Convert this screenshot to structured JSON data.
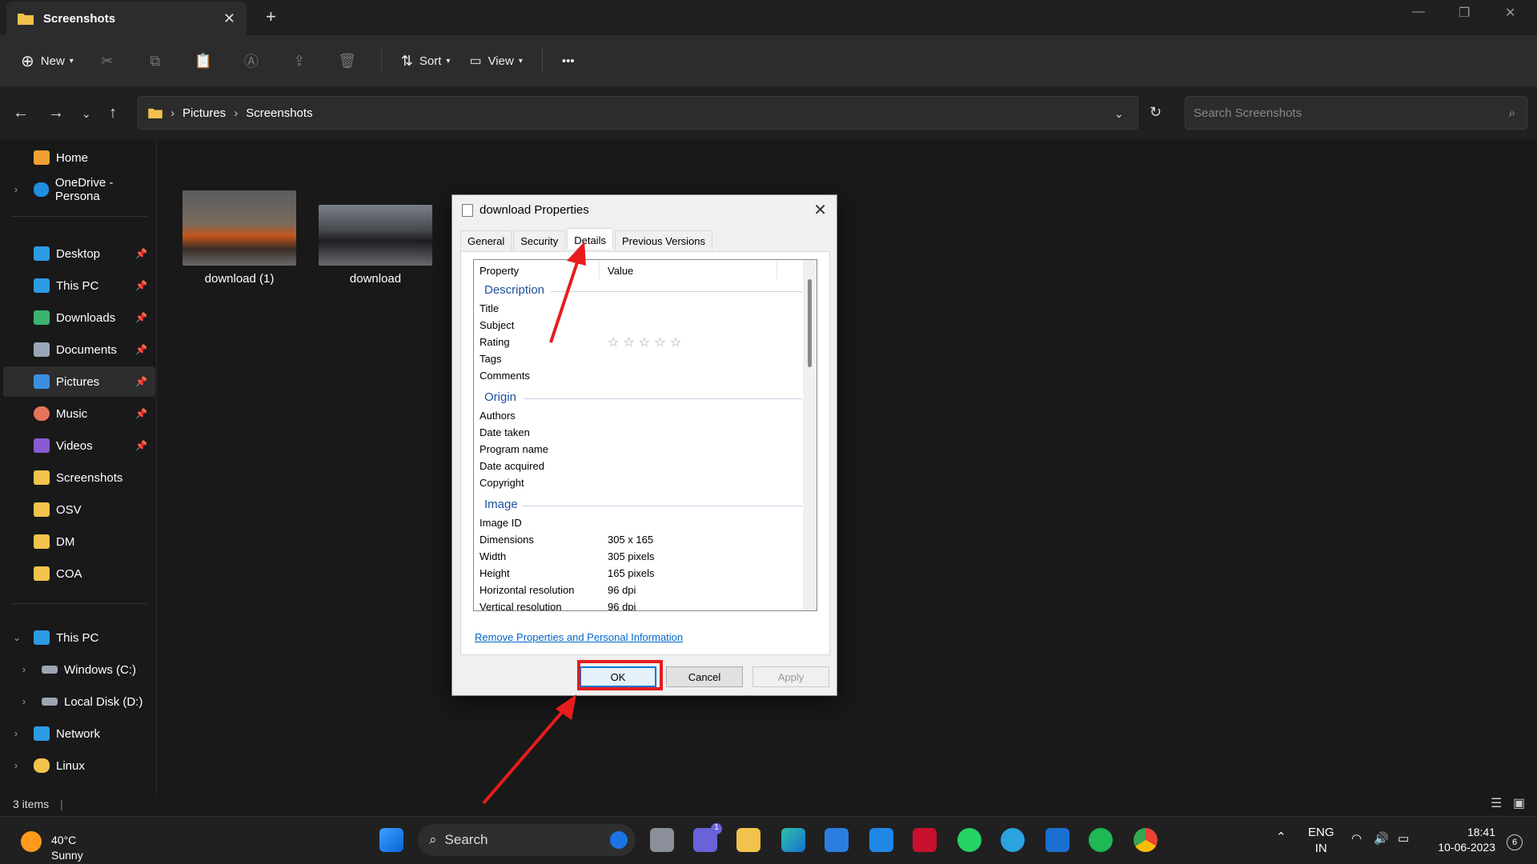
{
  "window": {
    "tab_title": "Screenshots",
    "new_tab": "+"
  },
  "toolbar": {
    "new_label": "New",
    "sort_label": "Sort",
    "view_label": "View",
    "more_label": "•••"
  },
  "address": {
    "crumbs": [
      "Pictures",
      "Screenshots"
    ],
    "search_placeholder": "Search Screenshots"
  },
  "sidebar": {
    "items": [
      {
        "label": "Home",
        "color": "#f0a030"
      },
      {
        "label": "OneDrive - Persona",
        "color": "#1f8fe0"
      },
      {
        "label": "Desktop",
        "color": "#2b9be3",
        "pinned": true
      },
      {
        "label": "This PC",
        "color": "#2b9be3",
        "pinned": true
      },
      {
        "label": "Downloads",
        "color": "#3cb371",
        "pinned": true
      },
      {
        "label": "Documents",
        "color": "#9aa6b8",
        "pinned": true
      },
      {
        "label": "Pictures",
        "color": "#3a8fe0",
        "pinned": true,
        "selected": true
      },
      {
        "label": "Music",
        "color": "#e8735a",
        "pinned": true
      },
      {
        "label": "Videos",
        "color": "#8a5ad0",
        "pinned": true
      },
      {
        "label": "Screenshots",
        "color": "#f2c24c"
      },
      {
        "label": "OSV",
        "color": "#f2c24c"
      },
      {
        "label": "DM",
        "color": "#f2c24c"
      },
      {
        "label": "COA",
        "color": "#f2c24c"
      },
      {
        "label": "This PC",
        "color": "#2b9be3"
      },
      {
        "label": "Windows (C:)",
        "color": "#9aa6b8"
      },
      {
        "label": "Local Disk (D:)",
        "color": "#9aa6b8"
      },
      {
        "label": "Network",
        "color": "#2b9be3"
      },
      {
        "label": "Linux",
        "color": "#f2c24c"
      }
    ]
  },
  "files": [
    {
      "name": "download (1)"
    },
    {
      "name": "download"
    }
  ],
  "status": {
    "items": "3 items"
  },
  "dialog": {
    "title": "download Properties",
    "tabs": [
      "General",
      "Security",
      "Details",
      "Previous Versions"
    ],
    "active_tab": "Details",
    "col_property": "Property",
    "col_value": "Value",
    "groups": {
      "description": "Description",
      "origin": "Origin",
      "image": "Image"
    },
    "description_rows": [
      {
        "p": "Title",
        "v": ""
      },
      {
        "p": "Subject",
        "v": ""
      },
      {
        "p": "Rating",
        "v": "☆ ☆ ☆ ☆ ☆"
      },
      {
        "p": "Tags",
        "v": ""
      },
      {
        "p": "Comments",
        "v": ""
      }
    ],
    "origin_rows": [
      {
        "p": "Authors",
        "v": ""
      },
      {
        "p": "Date taken",
        "v": ""
      },
      {
        "p": "Program name",
        "v": ""
      },
      {
        "p": "Date acquired",
        "v": ""
      },
      {
        "p": "Copyright",
        "v": ""
      }
    ],
    "image_rows": [
      {
        "p": "Image ID",
        "v": ""
      },
      {
        "p": "Dimensions",
        "v": "305 x 165"
      },
      {
        "p": "Width",
        "v": "305 pixels"
      },
      {
        "p": "Height",
        "v": "165 pixels"
      },
      {
        "p": "Horizontal resolution",
        "v": "96 dpi"
      },
      {
        "p": "Vertical resolution",
        "v": "96 dpi"
      }
    ],
    "link": "Remove Properties and Personal Information",
    "ok": "OK",
    "cancel": "Cancel",
    "apply": "Apply"
  },
  "taskbar": {
    "temp": "40°C",
    "weather": "Sunny",
    "search": "Search",
    "lang1": "ENG",
    "lang2": "IN",
    "time": "18:41",
    "date": "10-06-2023",
    "notif": "6",
    "teams_badge": "1"
  }
}
